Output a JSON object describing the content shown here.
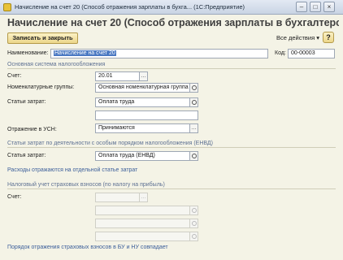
{
  "window": {
    "title": "Начисление на счет 20 (Способ отражения зарплаты  в бухга...  (1С:Предприятие)",
    "buttons": [
      "–",
      "□",
      "×"
    ]
  },
  "header": {
    "title": "Начисление на счет 20 (Способ отражения зарплаты  в бухгалтерском у..."
  },
  "toolbar": {
    "save_close_label": "Записать и закрыть",
    "all_actions_label": "Все действия ▾",
    "help_label": "?"
  },
  "form": {
    "name_label": "Наименование:",
    "name_value": "Начисление на счет 20",
    "code_label": "Код:",
    "code_value": "00-00003",
    "tax_section_title": "Основная система налогообложения",
    "account_label": "Счет:",
    "account_value": "20.01",
    "nomenclature_label": "Номенклатурные группы:",
    "nomenclature_value": "Основная номенклатурная группа",
    "cost_items_label": "Статьи затрат:",
    "cost_items_value": "Оплата труда",
    "usn_label": "Отражение в УСН:",
    "usn_value": "Принимаются",
    "envd_section_title": "Статьи затрат по деятельности с особым порядком налогообложения (ЕНВД)",
    "envd_cost_label": "Статья затрат:",
    "envd_cost_value": "Оплата труда (ЕНВД)",
    "envd_link": "Расходы отражаются на отдельной статье затрат",
    "insurance_section_title": "Налоговый учет страховых взносов (по налогу на прибыль)",
    "insurance_account_label": "Счет:",
    "insurance_link": "Порядок отражения страховых взносов в БУ и НУ совпадает"
  }
}
